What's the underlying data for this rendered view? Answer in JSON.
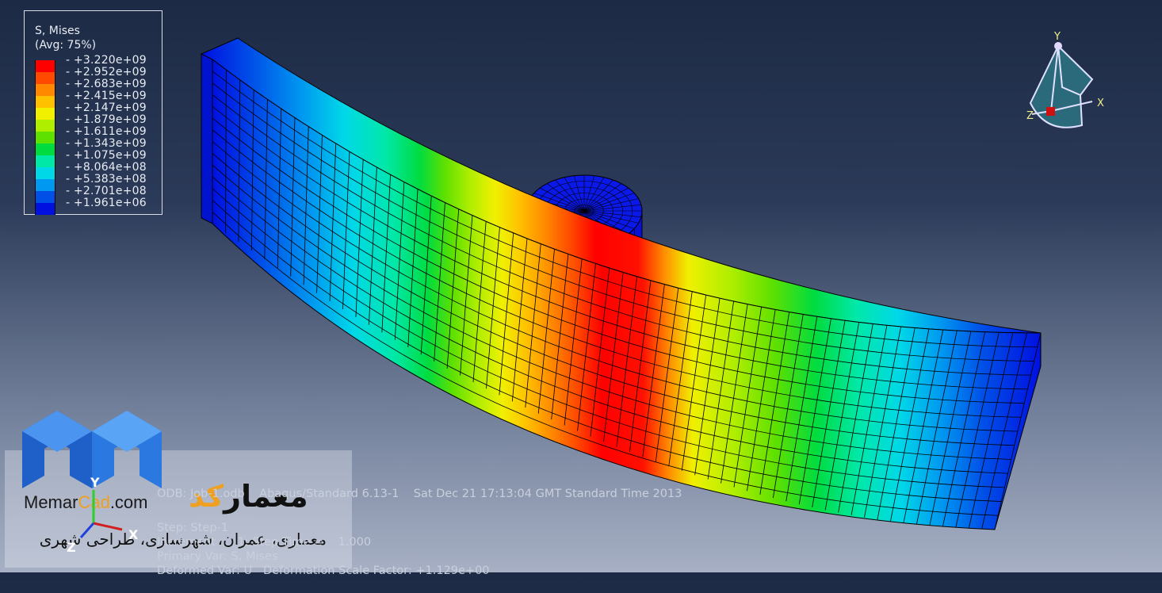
{
  "legend": {
    "title_line1": "S, Mises",
    "title_line2": "(Avg: 75%)",
    "entries": [
      {
        "label": "+3.220e+09",
        "color": "#ff0000"
      },
      {
        "label": "+2.952e+09",
        "color": "#ff4a00"
      },
      {
        "label": "+2.683e+09",
        "color": "#ff8800"
      },
      {
        "label": "+2.415e+09",
        "color": "#ffc000"
      },
      {
        "label": "+2.147e+09",
        "color": "#f0f000"
      },
      {
        "label": "+1.879e+09",
        "color": "#b0ee00"
      },
      {
        "label": "+1.611e+09",
        "color": "#5ee000"
      },
      {
        "label": "+1.343e+09",
        "color": "#00dc40"
      },
      {
        "label": "+1.075e+09",
        "color": "#00e8a8"
      },
      {
        "label": "+8.064e+08",
        "color": "#00d8e8"
      },
      {
        "label": "+5.383e+08",
        "color": "#0098f0"
      },
      {
        "label": "+2.701e+08",
        "color": "#0050e8"
      },
      {
        "label": "+1.961e+06",
        "color": "#0010e0"
      }
    ]
  },
  "info": {
    "line1": "ODB: Job-1.odb    Abaqus/Standard 6.13-1    Sat Dec 21 17:13:04 GMT Standard Time 2013",
    "line2": "Step: Step-1",
    "line3": "Increment      1: Step Time =    1.000",
    "line4": "Primary Var: S, Mises",
    "line5": "Deformed Var: U   Deformation Scale Factor: +1.129e+00"
  },
  "triad": {
    "y": "Y",
    "x": "X",
    "z": "Z"
  },
  "small_triad": {
    "y": "Y",
    "x": "X",
    "z": "Z"
  },
  "watermark": {
    "site_prefix": "Memar",
    "site_mid": "Cad",
    "site_suffix": ".com",
    "fa_main": "معمار",
    "fa_accent": "کد",
    "fa_sub": "معماری، عمران، شهرسازی، طراحی شهری"
  }
}
